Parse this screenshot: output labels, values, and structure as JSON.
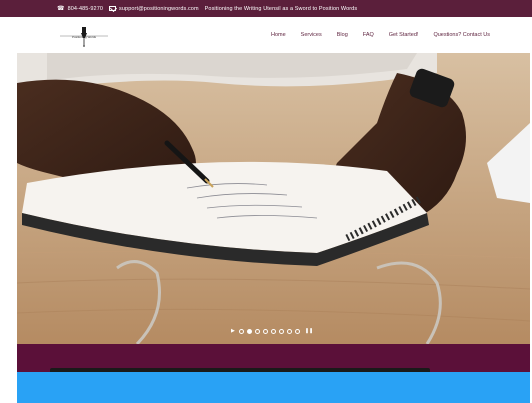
{
  "topbar": {
    "phone": "804-485-9270",
    "email": "support@positioningwords.com",
    "tagline": "Positioning the Writing Utensil as a Sword to Position Words"
  },
  "header": {
    "logo_text": "Positioning Words",
    "nav": [
      "Home",
      "Services",
      "Blog",
      "FAQ",
      "Get Started!",
      "Questions? Contact Us"
    ]
  },
  "slider": {
    "slide_count": 8,
    "active_index": 1
  },
  "colors": {
    "brand_maroon": "#5b1f3b",
    "band_maroon": "#5b1039",
    "blue_accent": "#29a2f5"
  }
}
